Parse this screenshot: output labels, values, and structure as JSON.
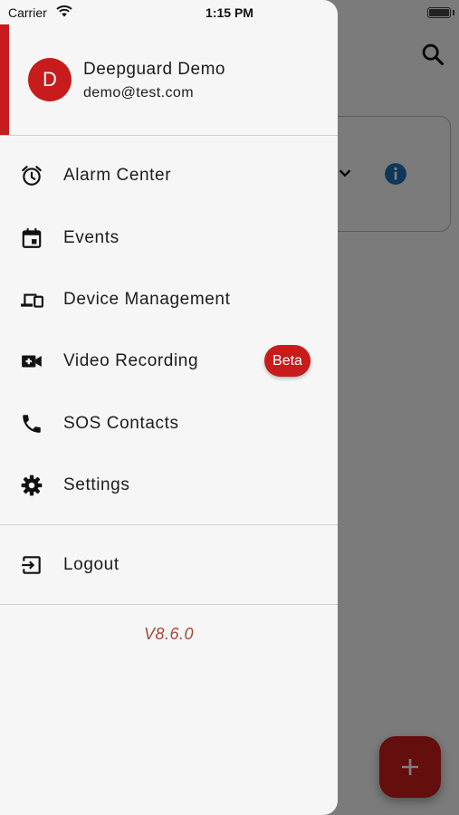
{
  "status_bar": {
    "carrier": "Carrier",
    "time": "1:15 PM"
  },
  "drawer": {
    "user": {
      "avatar_initial": "D",
      "name": "Deepguard Demo",
      "email": "demo@test.com"
    },
    "menu": [
      {
        "label": "Alarm Center",
        "icon": "alarm-clock-icon"
      },
      {
        "label": "Events",
        "icon": "calendar-icon"
      },
      {
        "label": "Device Management",
        "icon": "devices-icon"
      },
      {
        "label": "Video Recording",
        "icon": "video-camera-add-icon",
        "badge": "Beta"
      },
      {
        "label": "SOS Contacts",
        "icon": "phone-icon"
      },
      {
        "label": "Settings",
        "icon": "gear-icon"
      }
    ],
    "logout": {
      "label": "Logout",
      "icon": "logout-icon"
    },
    "version": "V8.6.0"
  },
  "background": {
    "icons": [
      "search-icon",
      "chevron-down-icon",
      "info-icon",
      "plus-icon"
    ]
  },
  "colors": {
    "accent": "#c81c1c",
    "drawer_bg": "#f6f6f6",
    "text": "#1c1c1c",
    "version_text": "#a04a36"
  }
}
